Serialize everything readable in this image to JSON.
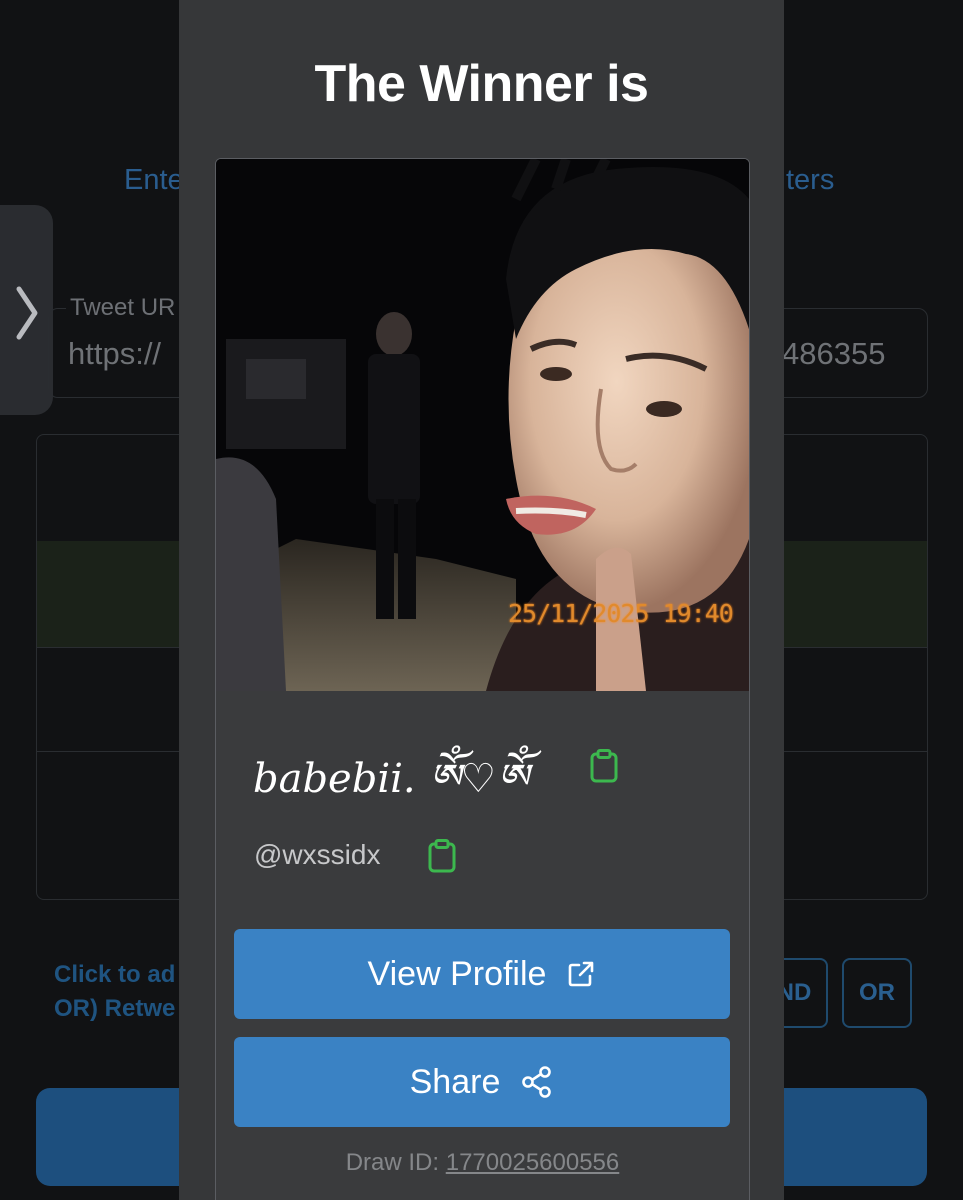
{
  "background": {
    "tabs": {
      "left_fragment": "Ente",
      "right_fragment": "ters"
    },
    "tweet_url": {
      "label": "Tweet UR",
      "value_left": "https://",
      "value_right": "486355"
    },
    "help_text": {
      "line1": "Click to ad",
      "line2": "OR) Retwe"
    },
    "logic_buttons": {
      "and": "ND",
      "or": "OR"
    }
  },
  "modal": {
    "title": "The Winner is",
    "winner": {
      "display_name": "babebii. ༀ♡ༀ",
      "username": "@wxssidx",
      "photo_timestamp": "25/11/2025 19:40"
    },
    "buttons": {
      "view_profile": "View Profile",
      "share": "Share"
    },
    "draw_id": {
      "label": "Draw ID:",
      "value": "1770025600556"
    }
  },
  "colors": {
    "accent": "#3a82c4",
    "copy_icon": "#3cb84e",
    "modal_bg": "#363739",
    "page_bg": "#111214"
  },
  "icons": {
    "sidebar_toggle": "chevron-right-icon",
    "copy": "clipboard-icon",
    "external": "external-link-icon",
    "share": "share-nodes-icon"
  }
}
